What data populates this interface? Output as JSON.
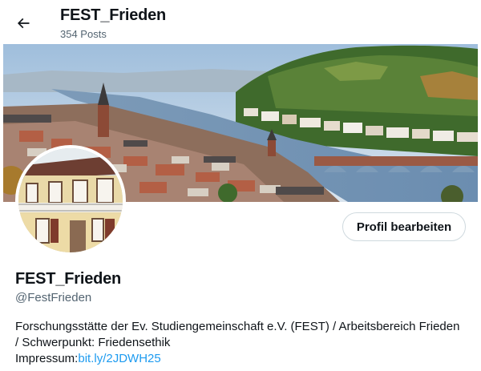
{
  "header": {
    "title": "FEST_Frieden",
    "posts_count": "354 Posts",
    "back_icon": "arrow-left-icon"
  },
  "banner": {
    "description_icon": "banner-image"
  },
  "profile": {
    "edit_button": "Profil bearbeiten",
    "display_name": "FEST_Frieden",
    "handle": "@FestFrieden",
    "bio_line1": "Forschungsstätte der Ev. Studiengemeinschaft e.V. (FEST) / Arbeitsbereich Frieden",
    "bio_line2": "/ Schwerpunkt: Friedensethik",
    "impressum_label": "Impressum:",
    "impressum_link": "bit.ly/2JDWH25"
  },
  "colors": {
    "text": "#0f1419",
    "muted": "#536471",
    "link": "#1d9bf0",
    "border": "#cfd9de"
  }
}
